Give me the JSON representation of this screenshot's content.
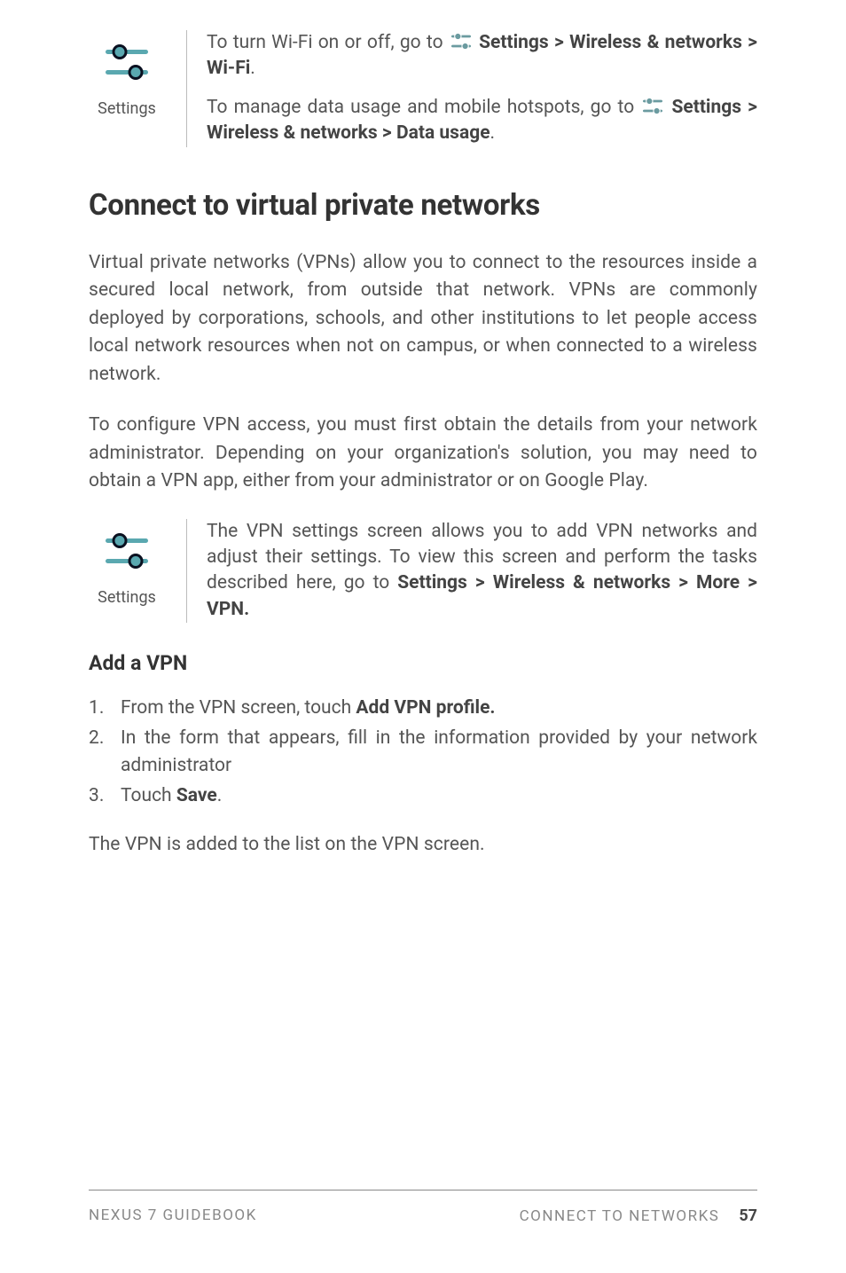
{
  "block1": {
    "caption": "Settings",
    "para1_pre": "To turn Wi-Fi on or off, go to ",
    "para1_bold": " Settings > Wireless & networks > Wi-Fi",
    "para1_post": ".",
    "para2_pre": "To manage data usage and mobile hotspots, go to ",
    "para2_bold": " Settings > Wireless & networks > Data usage",
    "para2_post": "."
  },
  "heading": "Connect to virtual private networks",
  "para1": "Virtual private networks (VPNs) allow you to connect to the resources inside a secured local network, from outside that network. VPNs are commonly deployed by corporations, schools, and other institutions to let people access local network resources when not on campus, or when connected to a wireless network.",
  "para2": "To configure VPN access, you must first obtain the details from your network administrator. Depending on your organization's solution, you may need to obtain a VPN app, either from your administrator or on Google Play.",
  "block2": {
    "caption": "Settings",
    "para_pre": "The VPN settings screen allows you to add VPN networks and adjust their settings. To view this screen and perform the tasks described here, go to ",
    "para_bold": "Settings > Wireless & networks > More > VPN."
  },
  "subheading": "Add a VPN",
  "list": {
    "item1_pre": "From the VPN screen, touch ",
    "item1_bold": "Add VPN profile.",
    "item2": "In the form that appears, fill in the information provided by your network administrator",
    "item3_pre": "Touch ",
    "item3_bold": "Save",
    "item3_post": "."
  },
  "outro": "The VPN is added to the list on the VPN screen.",
  "footer": {
    "left": "NEXUS 7 GUIDEBOOK",
    "right": "CONNECT TO NETWORKS",
    "page": "57"
  }
}
